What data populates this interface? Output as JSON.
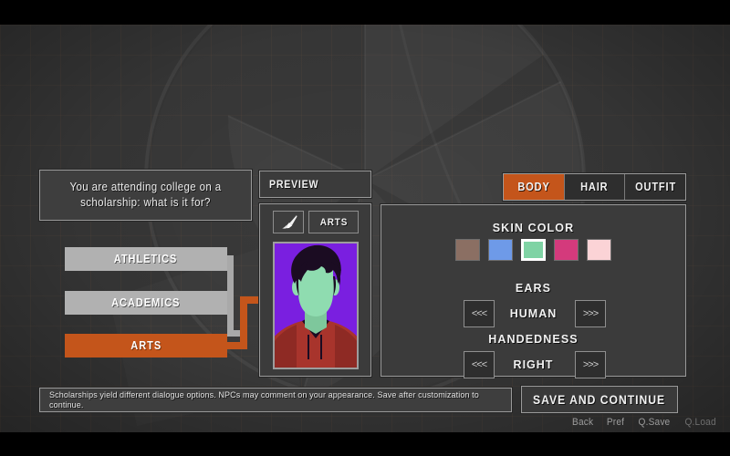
{
  "question": {
    "text": "You are attending college on a scholarship: what is it for?"
  },
  "choices": [
    {
      "label": "ATHLETICS",
      "selected": false
    },
    {
      "label": "ACADEMICS",
      "selected": false
    },
    {
      "label": "ARTS",
      "selected": true
    }
  ],
  "preview": {
    "header": "PREVIEW",
    "brush_icon": "paintbrush-icon",
    "track_label": "ARTS",
    "portrait": {
      "background": "#7a1fe0",
      "hair": "#1b0c22",
      "skin": "#8fdcb0",
      "shirt": "#a8342c",
      "collar": "#1b0c22"
    }
  },
  "tabs": [
    {
      "label": "BODY",
      "active": true
    },
    {
      "label": "HAIR",
      "active": false
    },
    {
      "label": "OUTFIT",
      "active": false
    }
  ],
  "customization": {
    "skin_color": {
      "title": "SKIN COLOR",
      "swatches": [
        {
          "color": "#8b6f63",
          "selected": false
        },
        {
          "color": "#6e9ae8",
          "selected": false
        },
        {
          "color": "#7fd3a4",
          "selected": true
        },
        {
          "color": "#d43a7c",
          "selected": false
        },
        {
          "color": "#fbd3d6",
          "selected": false
        }
      ]
    },
    "ears": {
      "title": "EARS",
      "value": "HUMAN",
      "prev": "<<<",
      "next": ">>>"
    },
    "handedness": {
      "title": "HANDEDNESS",
      "value": "RIGHT",
      "prev": "<<<",
      "next": ">>>"
    }
  },
  "status": {
    "text": "Scholarships yield different dialogue options. NPCs may comment on your appearance. Save after customization to continue."
  },
  "save_button": {
    "label": "SAVE AND CONTINUE"
  },
  "quick_menu": [
    {
      "label": "Back",
      "dim": false
    },
    {
      "label": "Pref",
      "dim": false
    },
    {
      "label": "Q.Save",
      "dim": false
    },
    {
      "label": "Q.Load",
      "dim": true
    }
  ],
  "theme": {
    "accent": "#c4551b",
    "panel_bg": "#3b3b3b",
    "stage_bg": "#343434",
    "border": "#9a9a9a",
    "idle_choice": "#b1b1b1"
  }
}
